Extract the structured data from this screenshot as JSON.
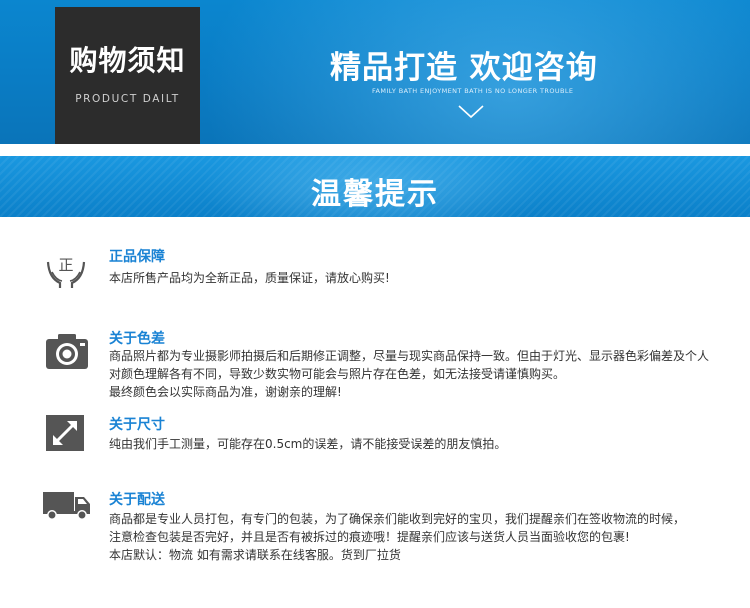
{
  "banner": {
    "title": "购物须知",
    "subtitle": "PRODUCT DAILT",
    "headline": "精品打造  欢迎咨询",
    "tagline": "FAMILY BATH ENJOYMENT BATH IS NO LONGER TROUBLE"
  },
  "notice": {
    "title": "温馨提示"
  },
  "sections": [
    {
      "icon": "genuine-hands-icon",
      "heading": "正品保障",
      "lines": [
        "本店所售产品均为全新正品，质量保证，请放心购买!"
      ]
    },
    {
      "icon": "camera-icon",
      "heading": "关于色差",
      "lines": [
        "商品照片都为专业摄影师拍摄后和后期修正调整，尽量与现实商品保持一致。但由于灯光、显示器色彩偏差及个人",
        "对颜色理解各有不同，导致少数实物可能会与照片存在色差，如无法接受请谨慎购买。",
        "最终颜色会以实际商品为准，谢谢亲的理解!"
      ]
    },
    {
      "icon": "resize-arrow-icon",
      "heading": "关于尺寸",
      "lines": [
        "纯由我们手工测量，可能存在0.5cm的误差，请不能接受误差的朋友慎拍。"
      ]
    },
    {
      "icon": "delivery-truck-icon",
      "heading": "关于配送",
      "lines": [
        "商品都是专业人员打包，有专门的包装，为了确保亲们能收到完好的宝贝，我们提醒亲们在签收物流的时候，",
        "注意检查包装是否完好，并且是否有被拆过的痕迹哦！提醒亲们应该与送货人员当面验收您的包裹!",
        "本店默认：物流 如有需求请联系在线客服。货到厂拉货"
      ]
    }
  ],
  "colors": {
    "banner_blue": "#0a7cc4",
    "dark_box": "#2c2c2c",
    "heading_blue": "#1a83d4",
    "body_text": "#333333",
    "icon_gray": "#555555"
  }
}
